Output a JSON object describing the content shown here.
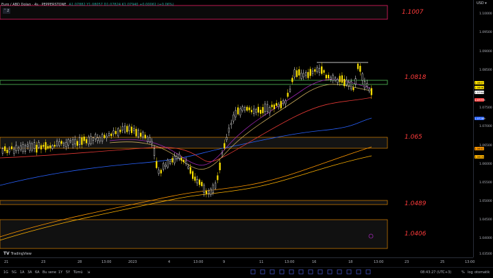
{
  "header": {
    "symbol": "Euro / ABD Doları · 4s · PEPPERSTONE",
    "ohlc": "A1.07882 Y1.08057 D1.07824 K1.07940 +0.00061 (+0.06%)",
    "indicator_toggle": "˅ 2"
  },
  "zones": [
    {
      "label": "1.1007"
    },
    {
      "label": "1.0818"
    },
    {
      "label": "1.065"
    },
    {
      "label": "1.0489"
    },
    {
      "label": "1.0406"
    }
  ],
  "price_axis": {
    "currency": "USD ▾",
    "ticks": [
      "1.10000",
      "1.09500",
      "1.09000",
      "1.08500",
      "1.07500",
      "1.07000",
      "1.06500",
      "1.06000",
      "1.05500",
      "1.05000",
      "1.04500",
      "1.04000",
      "1.03500"
    ],
    "tags": [
      {
        "text": "1.08077",
        "color": "#ffe400"
      },
      {
        "text": "1.08063",
        "color": "#ffe400"
      },
      {
        "text": "1.07940",
        "color": "#ffffff"
      },
      {
        "text": "1.07775",
        "color": "#ff4444"
      },
      {
        "text": "1.07289",
        "color": "#2962ff"
      },
      {
        "text": "1.06417",
        "color": "#ff9800"
      },
      {
        "text": "1.06196",
        "color": "#ffb300"
      }
    ]
  },
  "time_axis": {
    "labels": [
      "21",
      "23",
      "28",
      "13:00",
      "2023",
      "4",
      "13:00",
      "9",
      "11",
      "13:00",
      "16",
      "18",
      "13:00",
      "23",
      "25",
      "13:00"
    ]
  },
  "toolbar": {
    "timeframes": [
      "1G",
      "5G",
      "1A",
      "3A",
      "6A",
      "Bu sene",
      "1Y",
      "5Y",
      "Tümü"
    ],
    "clock": "08:43:27 (UTC+3)",
    "percent": "%",
    "log": "log",
    "auto": "otomatik"
  },
  "logo": {
    "text": "TradingView"
  },
  "colors": {
    "zone_red": "#ff3b3b",
    "green_zone": "#4caf50",
    "candle": "#ffe400",
    "ma_blue": "#2962ff",
    "ma_orange": "#ff9800",
    "ma_red": "#e53935",
    "ma_purple": "#9c27b0"
  }
}
